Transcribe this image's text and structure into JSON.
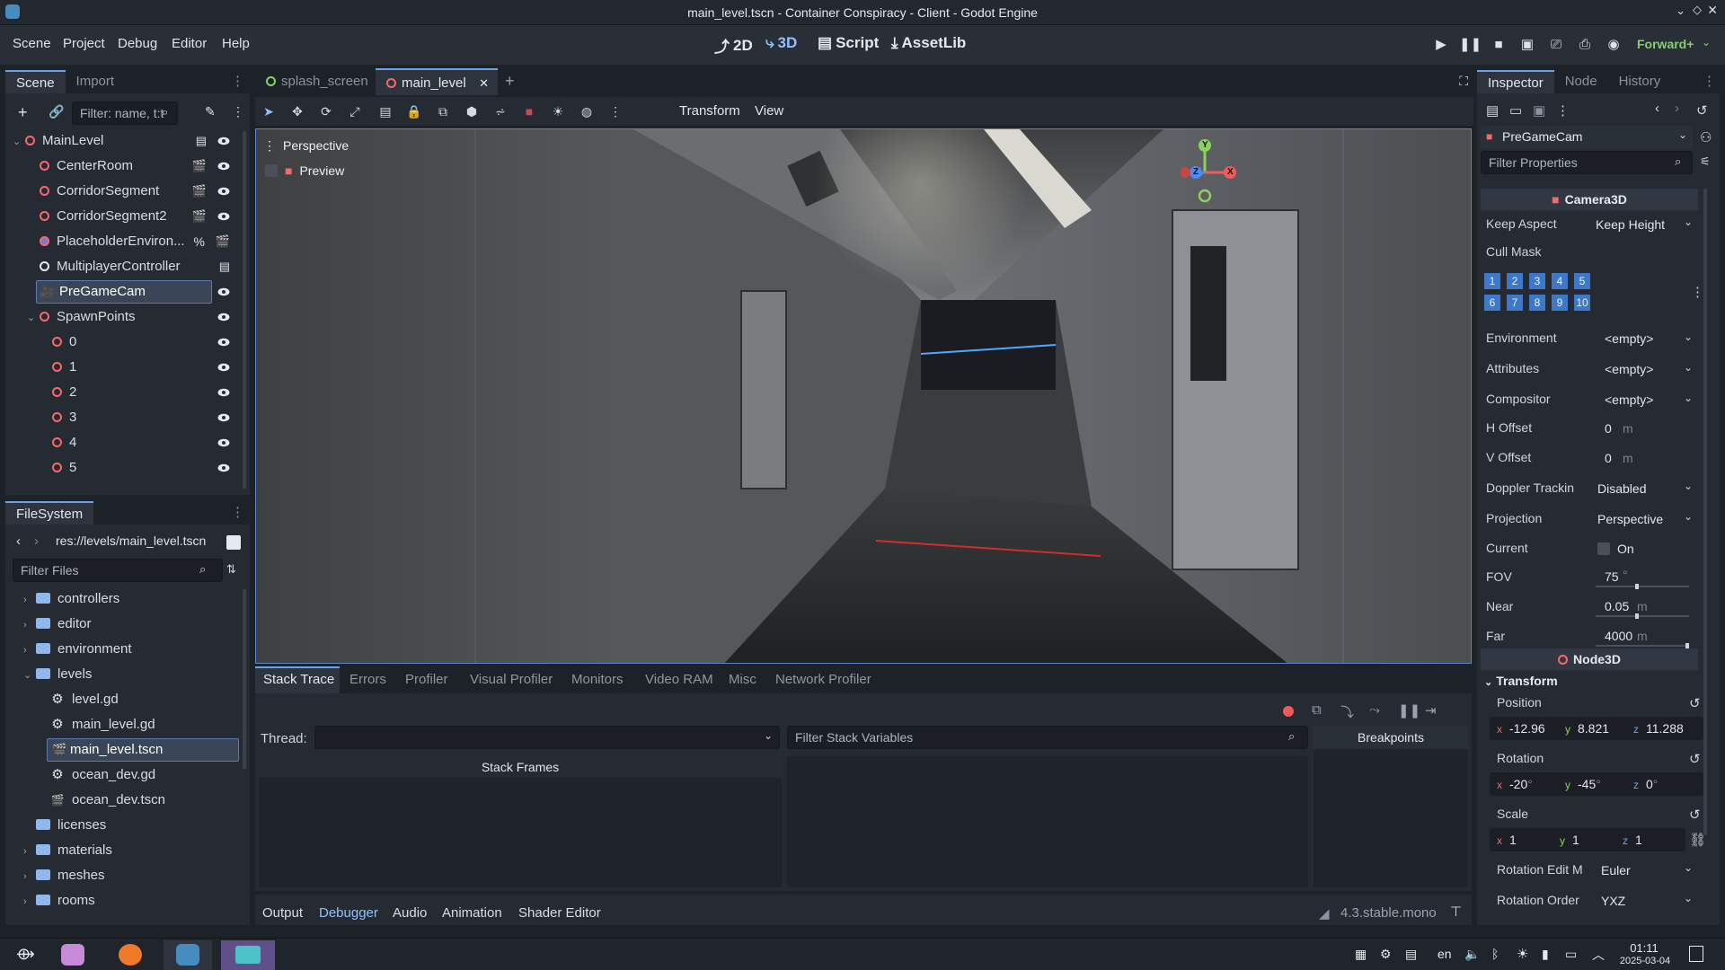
{
  "window": {
    "title": "main_level.tscn - Container Conspiracy - Client - Godot Engine"
  },
  "menu": {
    "items": [
      "Scene",
      "Project",
      "Debug",
      "Editor",
      "Help"
    ]
  },
  "workspaces": {
    "d2": "2D",
    "d3": "3D",
    "script": "Script",
    "assetlib": "AssetLib"
  },
  "renderer": "Forward+",
  "scene_dock": {
    "tabs": {
      "scene": "Scene",
      "import": "Import"
    },
    "filter_placeholder": "Filter: name, t:t",
    "nodes": [
      {
        "label": "MainLevel",
        "level": 0
      },
      {
        "label": "CenterRoom",
        "level": 1
      },
      {
        "label": "CorridorSegment",
        "level": 1
      },
      {
        "label": "CorridorSegment2",
        "level": 1
      },
      {
        "label": "PlaceholderEnviron...",
        "level": 1
      },
      {
        "label": "MultiplayerController",
        "level": 1
      },
      {
        "label": "PreGameCam",
        "level": 1,
        "selected": true
      },
      {
        "label": "SpawnPoints",
        "level": 1
      },
      {
        "label": "0",
        "level": 2
      },
      {
        "label": "1",
        "level": 2
      },
      {
        "label": "2",
        "level": 2
      },
      {
        "label": "3",
        "level": 2
      },
      {
        "label": "4",
        "level": 2
      },
      {
        "label": "5",
        "level": 2
      }
    ]
  },
  "filesystem": {
    "title": "FileSystem",
    "path": "res://levels/main_level.tscn",
    "filter_placeholder": "Filter Files",
    "items": [
      "controllers",
      "editor",
      "environment",
      "levels",
      "level.gd",
      "main_level.gd",
      "main_level.tscn",
      "ocean_dev.gd",
      "ocean_dev.tscn",
      "licenses",
      "materials",
      "meshes",
      "rooms"
    ]
  },
  "editor_tabs": {
    "splash": "splash_screen",
    "main": "main_level"
  },
  "viewport": {
    "toolbar": {
      "transform": "Transform",
      "view": "View"
    },
    "perspective": "Perspective",
    "preview": "Preview",
    "gizmo": {
      "y": "Y",
      "z": "Z",
      "x": "X"
    }
  },
  "debugger": {
    "tabs": [
      "Stack Trace",
      "Errors",
      "Profiler",
      "Visual Profiler",
      "Monitors",
      "Video RAM",
      "Misc",
      "Network Profiler"
    ],
    "thread_label": "Thread:",
    "filter_placeholder": "Filter Stack Variables",
    "stack_frames": "Stack Frames",
    "breakpoints": "Breakpoints"
  },
  "bottom_panel": {
    "tabs": [
      "Output",
      "Debugger",
      "Audio",
      "Animation",
      "Shader Editor"
    ],
    "version": "4.3.stable.mono"
  },
  "inspector": {
    "tabs": {
      "inspector": "Inspector",
      "node": "Node",
      "history": "History"
    },
    "object": "PreGameCam",
    "filter_placeholder": "Filter Properties",
    "section_camera": "Camera3D",
    "keep_aspect": {
      "label": "Keep Aspect",
      "value": "Keep Height"
    },
    "cull_mask": {
      "label": "Cull Mask",
      "layers": [
        "1",
        "2",
        "3",
        "4",
        "5",
        "6",
        "7",
        "8",
        "9",
        "10"
      ]
    },
    "environment": {
      "label": "Environment",
      "value": "<empty>"
    },
    "attributes": {
      "label": "Attributes",
      "value": "<empty>"
    },
    "compositor": {
      "label": "Compositor",
      "value": "<empty>"
    },
    "h_offset": {
      "label": "H Offset",
      "value": "0",
      "unit": "m"
    },
    "v_offset": {
      "label": "V Offset",
      "value": "0",
      "unit": "m"
    },
    "doppler": {
      "label": "Doppler Trackin",
      "value": "Disabled"
    },
    "projection": {
      "label": "Projection",
      "value": "Perspective"
    },
    "current": {
      "label": "Current",
      "value": "On"
    },
    "fov": {
      "label": "FOV",
      "value": "75",
      "unit": "°"
    },
    "near": {
      "label": "Near",
      "value": "0.05",
      "unit": "m"
    },
    "far": {
      "label": "Far",
      "value": "4000",
      "unit": "m"
    },
    "section_node3d": "Node3D",
    "transform": "Transform",
    "position": {
      "label": "Position",
      "x": "-12.96",
      "y": "8.821",
      "z": "11.288"
    },
    "rotation": {
      "label": "Rotation",
      "x": "-20",
      "y": "-45",
      "z": "0",
      "unit": "°"
    },
    "scale": {
      "label": "Scale",
      "x": "1",
      "y": "1",
      "z": "1"
    },
    "rotation_edit_mode": {
      "label": "Rotation Edit M",
      "value": "Euler"
    },
    "rotation_order": {
      "label": "Rotation Order",
      "value": "YXZ"
    }
  },
  "taskbar": {
    "lang": "en",
    "time": "01:11",
    "date": "2025-03-04"
  }
}
